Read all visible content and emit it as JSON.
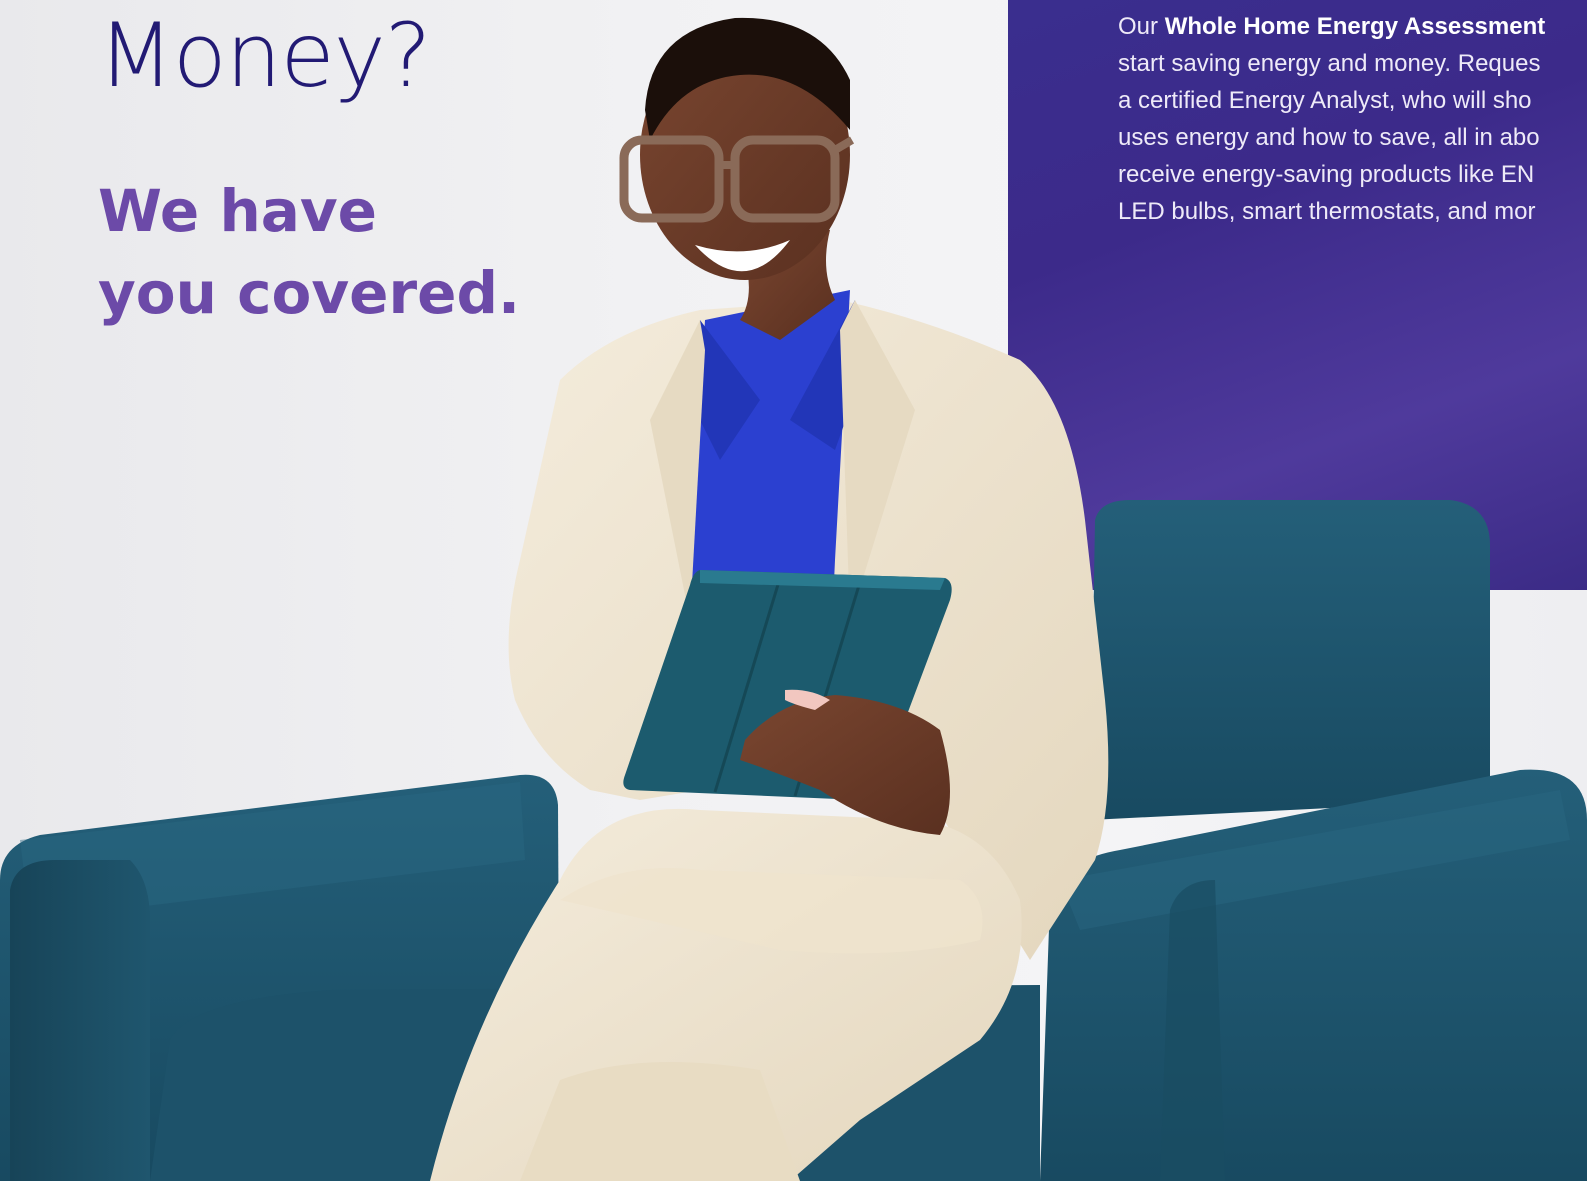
{
  "headline": {
    "question_tail": "Money?",
    "answer_line1": "We have",
    "answer_line2": "you covered."
  },
  "body": {
    "lead": "Our ",
    "program_name": "Whole Home Energy Assessment",
    "line1_tail": " ",
    "lines": [
      "start saving energy and money. Reques",
      "a certified Energy Analyst, who will sho",
      "uses energy and how to save, all in abo",
      "receive energy-saving products like EN",
      "LED bulbs, smart thermostats, and mor"
    ]
  },
  "photo": {
    "subject": "smiling-woman-in-cream-suit-holding-tablet",
    "chair": "teal-armchair"
  },
  "colors": {
    "panel": "#3a2e8e",
    "headline_navy": "#221a74",
    "headline_purple": "#6c4aa8",
    "chair_teal": "#1f5670",
    "suit_cream": "#efe6d3",
    "blouse_blue": "#2a3fcf"
  }
}
